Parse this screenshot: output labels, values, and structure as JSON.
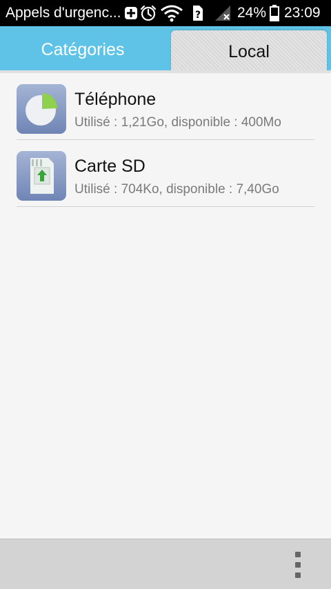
{
  "status_bar": {
    "notification_text": "Appels d'urgenc...",
    "battery_percent": "24%",
    "time": "23:09",
    "icons": [
      "add-box-icon",
      "alarm-icon",
      "wifi-icon",
      "sim-unknown-icon",
      "signal-no-service-icon",
      "battery-icon"
    ]
  },
  "tabs": [
    {
      "label": "Catégories",
      "active": false
    },
    {
      "label": "Local",
      "active": true
    }
  ],
  "storage": [
    {
      "title": "Téléphone",
      "subtitle": "Utilisé : 1,21Go, disponible : 400Mo",
      "icon": "phone-storage-pie-icon"
    },
    {
      "title": "Carte SD",
      "subtitle": "Utilisé : 704Ko, disponible : 7,40Go",
      "icon": "sd-card-icon"
    }
  ],
  "bottom_bar": {
    "menu_icon": "overflow-menu-icon"
  },
  "colors": {
    "tab_bar": "#5ec3e6",
    "icon_background": "#7f93c0",
    "pie_accent": "#8fd14f",
    "arrow": "#3aa43a"
  }
}
